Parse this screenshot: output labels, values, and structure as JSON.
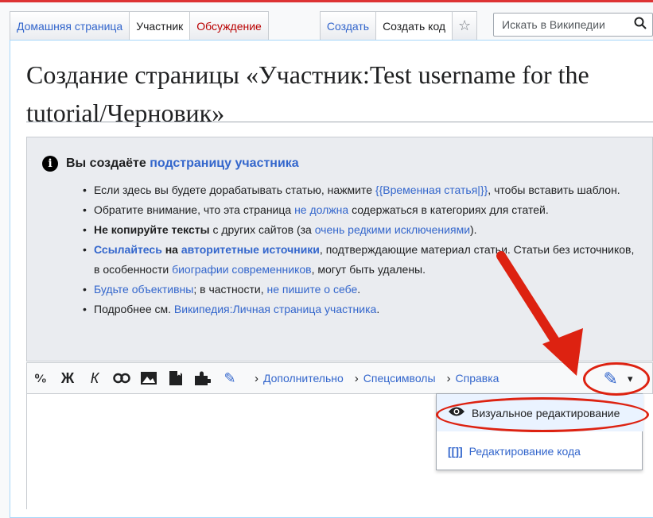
{
  "tabs": {
    "main": "Домашняя страница",
    "user": "Участник",
    "talk": "Обсуждение",
    "create": "Создать",
    "create_code": "Создать код"
  },
  "search": {
    "placeholder": "Искать в Википедии"
  },
  "page_title": "Создание страницы «Участник:Test username for the tutorial/Черновик»",
  "notice": {
    "heading_prefix": "Вы создаёте",
    "heading_link": "подстраницу участника",
    "bullets": [
      {
        "a": "Если здесь вы будете дорабатывать статью, нажмите ",
        "link": "{{Временная статья|}}",
        "b": ", чтобы вставить шаблон."
      },
      {
        "a": "Обратите внимание, что эта страница ",
        "link": "не должна",
        "b": " содержаться в категориях для статей."
      },
      {
        "bold": "Не копируйте тексты",
        "a": " с других сайтов (за ",
        "link": "очень редкими исключениями",
        "b": ")."
      },
      {
        "link_bold": "Ссылайтесь",
        "a": " на ",
        "link2_bold": "авторитетные источники",
        "b": ", подтверждающие материал статьи. Статьи без источников, в особенности ",
        "link": "биографии современников",
        "c": ", могут быть удалены."
      },
      {
        "link": "Будьте объективны",
        "a": "; в частности, ",
        "link2": "не пишите о себе",
        "b": "."
      },
      {
        "a": "Подробнее см. ",
        "link": "Википедия:Личная страница участника",
        "b": "."
      }
    ]
  },
  "toolbar": {
    "bold": "Ж",
    "italic": "К",
    "advanced": "Дополнительно",
    "special_chars": "Спецсимволы",
    "help": "Справка"
  },
  "editor_menu": {
    "visual": "Визуальное редактирование",
    "source": "Редактирование кода",
    "source_icon": "[[]]"
  },
  "colors": {
    "link": "#3366cc",
    "annotation": "#dd2211"
  }
}
